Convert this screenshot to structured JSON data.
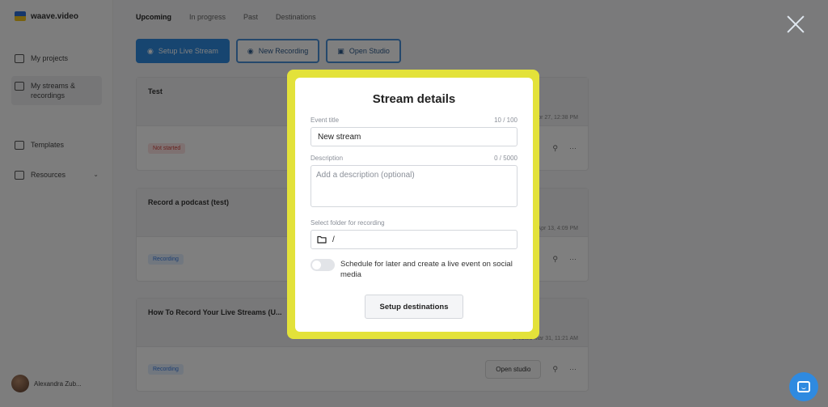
{
  "sidebar": {
    "logo_text": "waave.video",
    "items": [
      {
        "label": "My projects",
        "icon": "folder-icon"
      },
      {
        "label": "My streams & recordings",
        "icon": "video-icon"
      },
      {
        "label": "Templates",
        "icon": "template-icon"
      },
      {
        "label": "Resources",
        "icon": "book-icon"
      }
    ],
    "user_name": "Alexandra Zub..."
  },
  "tabs": [
    "Upcoming",
    "In progress",
    "Past",
    "Destinations"
  ],
  "toolbar": {
    "setup_live": "Setup Live Stream",
    "new_recording": "New Recording",
    "open_studio": "Open Studio"
  },
  "cards": [
    {
      "title": "Test",
      "badge": "Not started",
      "badge_color": "red",
      "time": "Created Apr 27, 12:38 PM"
    },
    {
      "title": "Record a podcast (test)",
      "badge": "Recording",
      "badge_color": "blue",
      "time": "Created Apr 13, 4:09 PM"
    },
    {
      "title": "How To Record Your Live Streams (U...",
      "badge": "Recording",
      "badge_color": "blue",
      "time": "Created Mar 31, 11:21 AM",
      "action": "Open studio"
    }
  ],
  "modal": {
    "title": "Stream details",
    "event_title_label": "Event title",
    "event_title_count": "10 / 100",
    "event_title_value": "New stream",
    "description_label": "Description",
    "description_count": "0 / 5000",
    "description_placeholder": "Add a description (optional)",
    "folder_label": "Select folder for recording",
    "folder_value": "/",
    "schedule_label": "Schedule for later and create a live event on social media",
    "schedule_enabled": false,
    "setup_button": "Setup destinations"
  },
  "colors": {
    "highlight": "#e3e23a",
    "primary": "#2f8ae0",
    "overlay": "rgba(0,0,0,0.5)"
  }
}
